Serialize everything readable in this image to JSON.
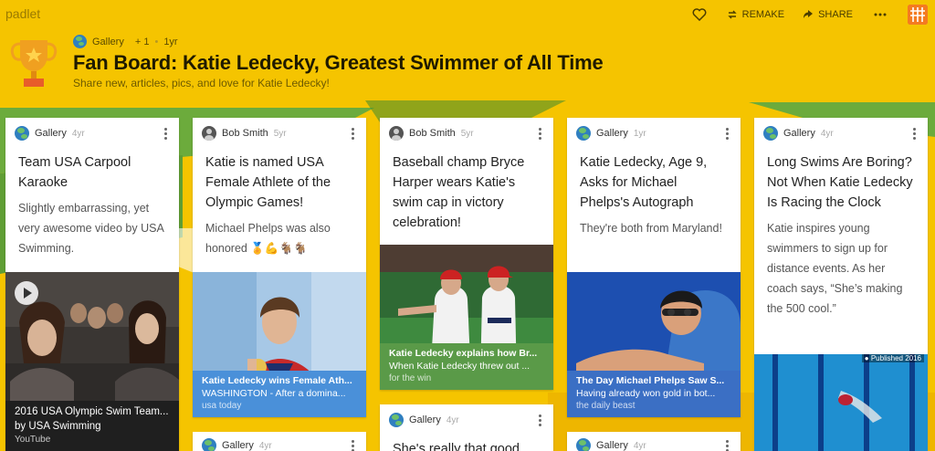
{
  "topbar": {
    "logo": "padlet",
    "remake_label": "REMAKE",
    "share_label": "SHARE"
  },
  "header": {
    "author": "Gallery",
    "likes": "+ 1",
    "age": "1yr",
    "title": "Fan Board: Katie Ledecky, Greatest Swimmer of All Time",
    "subtitle": "Share new, articles, pics, and love for Katie Ledecky!"
  },
  "cards": [
    {
      "author": "Gallery",
      "age": "4yr",
      "title": "Team USA Carpool Karaoke",
      "body": "Slightly embarrassing, yet very awesome video by USA Swimming.",
      "caption_title": "2016 USA Olympic Swim Team...",
      "caption_sub": "by USA Swimming",
      "caption_domain": "YouTube"
    },
    {
      "author": "Bob Smith",
      "age": "5yr",
      "title": "Katie is named USA Female Athlete of the Olympic Games!",
      "body": "Michael Phelps was also honored 🏅💪🐐🐐",
      "caption_title": "Katie Ledecky wins Female Ath...",
      "caption_sub": "WASHINGTON - After a domina...",
      "caption_domain": "usa today"
    },
    {
      "author": "Bob Smith",
      "age": "5yr",
      "title": "Baseball champ Bryce Harper wears Katie's swim cap in victory celebration!",
      "caption_title": "Katie Ledecky explains how Br...",
      "caption_sub": "When Katie Ledecky threw out ...",
      "caption_domain": "for the win"
    },
    {
      "author": "Gallery",
      "age": "1yr",
      "title": "Katie Ledecky, Age 9, Asks for Michael Phelps's Autograph",
      "body": "They're both from Maryland!",
      "caption_title": "The Day Michael Phelps Saw S...",
      "caption_sub": "Having already won gold in bot...",
      "caption_domain": "the daily beast"
    },
    {
      "author": "Gallery",
      "age": "4yr",
      "title": "Long Swims Are Boring? Not When Katie Ledecky Is Racing the Clock",
      "body": "Katie inspires young swimmers to sign up for distance events. As her coach says, “She’s making the 500 cool.”",
      "photo_tag": "Published 2016"
    },
    {
      "author": "Gallery",
      "age": "4yr"
    },
    {
      "author": "Gallery",
      "age": "4yr",
      "title": "She's really that good"
    },
    {
      "author": "Gallery",
      "age": "4yr"
    }
  ],
  "colors": {
    "background": "#f5c400",
    "card_caption_blue": "#4a90d9",
    "card_caption_green": "#5a9a48",
    "card_caption_dark": "#222222"
  }
}
